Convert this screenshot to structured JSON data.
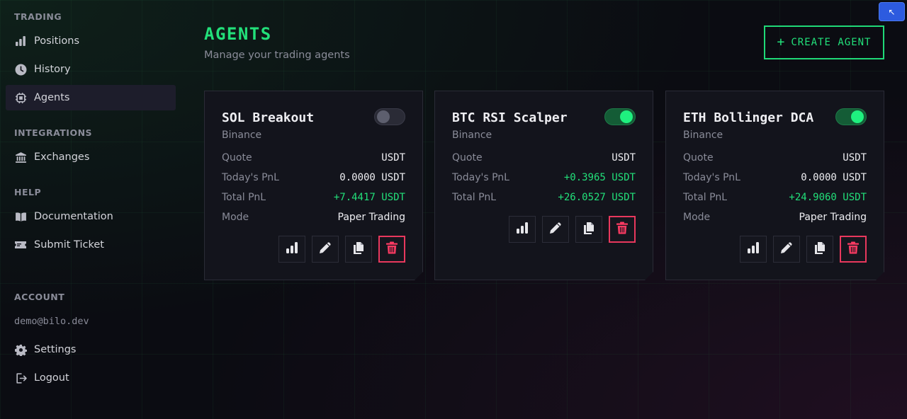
{
  "sidebar": {
    "trading_label": "TRADING",
    "positions": "Positions",
    "history": "History",
    "agents": "Agents",
    "integrations_label": "INTEGRATIONS",
    "exchanges": "Exchanges",
    "help_label": "HELP",
    "documentation": "Documentation",
    "submit_ticket": "Submit Ticket",
    "account_label": "ACCOUNT",
    "email": "demo@bilo.dev",
    "settings": "Settings",
    "logout": "Logout"
  },
  "header": {
    "title": "AGENTS",
    "subtitle": "Manage your trading agents",
    "create_label": "CREATE AGENT",
    "create_icon": "+",
    "corner_icon": "↖"
  },
  "labels": {
    "quote": "Quote",
    "todays_pnl": "Today's PnL",
    "total_pnl": "Total PnL",
    "mode": "Mode"
  },
  "agents": [
    {
      "name": "SOL Breakout",
      "exchange": "Binance",
      "enabled": false,
      "quote": "USDT",
      "todays_pnl": "0.0000 USDT",
      "total_pnl": "+7.4417 USDT",
      "mode": "Paper Trading"
    },
    {
      "name": "BTC RSI Scalper",
      "exchange": "Binance",
      "enabled": true,
      "quote": "USDT",
      "todays_pnl": "+0.3965 USDT",
      "total_pnl": "+26.0527 USDT",
      "mode": ""
    },
    {
      "name": "ETH Bollinger DCA",
      "exchange": "Binance",
      "enabled": true,
      "quote": "USDT",
      "todays_pnl": "0.0000 USDT",
      "total_pnl": "+24.9060 USDT",
      "mode": "Paper Trading"
    }
  ],
  "colors": {
    "accent": "#22e07a",
    "danger": "#ff3b63",
    "background": "#0b0c12",
    "card": "#13141c"
  },
  "icons": {
    "positions": "bar-chart-icon",
    "history": "clock-icon",
    "agents": "chip-icon",
    "exchanges": "bank-icon",
    "documentation": "book-icon",
    "submit_ticket": "ticket-icon",
    "settings": "gear-icon",
    "logout": "logout-icon",
    "stats": "bar-chart-icon",
    "edit": "pencil-icon",
    "duplicate": "copy-icon",
    "delete": "trash-icon"
  }
}
